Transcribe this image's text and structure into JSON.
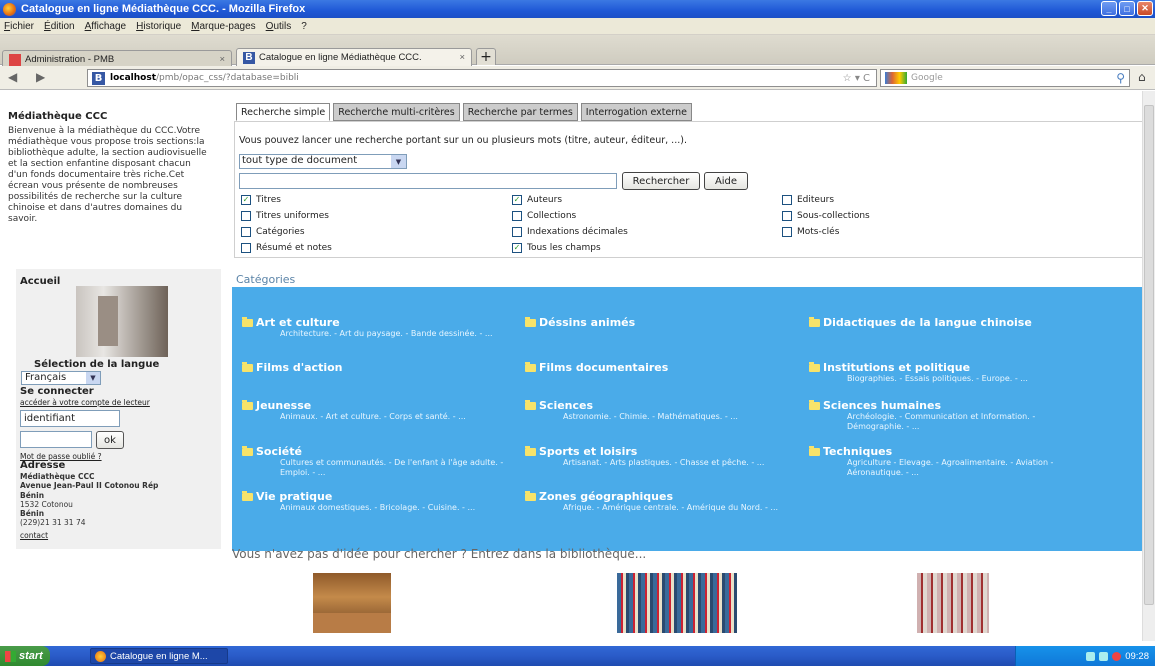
{
  "window": {
    "title": "Catalogue en ligne Médiathèque CCC. - Mozilla Firefox"
  },
  "menubar": [
    "Fichier",
    "Édition",
    "Affichage",
    "Historique",
    "Marque-pages",
    "Outils",
    "?"
  ],
  "tabs": [
    {
      "label": "Administration - PMB"
    },
    {
      "label": "Catalogue en ligne Médiathèque CCC."
    }
  ],
  "url": {
    "host": "localhost",
    "rest": "/pmb/opac_css/?database=bibli"
  },
  "google": {
    "placeholder": "Google"
  },
  "sidebar": {
    "heading": "Médiathèque CCC",
    "intro": "Bienvenue à la médiathèque du CCC.Votre médiathèque vous propose trois sections:la bibliothèque adulte, la section audiovisuelle et la section enfantine disposant chacun d'un fonds documentaire très riche.Cet écrean vous présente de nombreuses possibilités de recherche sur la culture chinoise et dans d'autres domaines du savoir.",
    "accueil": "Accueil",
    "lang_label": "Sélection de la langue",
    "lang_value": "Français",
    "connect": "Se connecter",
    "account_link": "accéder à votre compte de lecteur",
    "login_value": "identifiant",
    "ok": "ok",
    "forgot": "Mot de passe oublié ?",
    "address_label": "Adresse",
    "address_lines": [
      "Médiathèque CCC",
      "Avenue Jean-Paul II Cotonou Rép",
      "Bénin",
      "1532 Cotonou",
      "Bénin",
      "(229)21 31 31 74"
    ],
    "contact": "contact"
  },
  "search_tabs": [
    "Recherche simple",
    "Recherche multi-critères",
    "Recherche par termes",
    "Interrogation externe"
  ],
  "search": {
    "description": "Vous pouvez lancer une recherche portant sur un ou plusieurs mots (titre, auteur, éditeur, ...).",
    "doc_type": "tout type de document",
    "search_btn": "Rechercher",
    "help_btn": "Aide",
    "fields": [
      {
        "label": "Titres",
        "checked": true
      },
      {
        "label": "Auteurs",
        "checked": true
      },
      {
        "label": "Editeurs",
        "checked": false
      },
      {
        "label": "Titres uniformes",
        "checked": false
      },
      {
        "label": "Collections",
        "checked": false
      },
      {
        "label": "Sous-collections",
        "checked": false
      },
      {
        "label": "Catégories",
        "checked": false
      },
      {
        "label": "Indexations décimales",
        "checked": false
      },
      {
        "label": "Mots-clés",
        "checked": false
      },
      {
        "label": "Résumé et notes",
        "checked": false
      },
      {
        "label": "Tous les champs",
        "checked": true
      }
    ]
  },
  "categories_title": "Catégories",
  "categories": [
    {
      "name": "Art et culture",
      "sub": "Architecture. - Art du paysage. - Bande dessinée. - ..."
    },
    {
      "name": "Déssins animés",
      "sub": ""
    },
    {
      "name": "Didactiques de la langue chinoise",
      "sub": ""
    },
    {
      "name": "Films d'action",
      "sub": ""
    },
    {
      "name": "Films documentaires",
      "sub": ""
    },
    {
      "name": "Institutions et politique",
      "sub": "Biographies. - Essais politiques. - Europe. - ..."
    },
    {
      "name": "Jeunesse",
      "sub": "Animaux. - Art et culture. - Corps et santé. - ..."
    },
    {
      "name": "Sciences",
      "sub": "Astronomie. - Chimie. - Mathématiques. - ..."
    },
    {
      "name": "Sciences humaines",
      "sub": "Archéologie. - Communication et Information. - Démographie. - ..."
    },
    {
      "name": "Société",
      "sub": "Cultures et communautés. - De l'enfant à l'âge adulte. - Emploi. - ..."
    },
    {
      "name": "Sports et loisirs",
      "sub": "Artisanat. - Arts plastiques. - Chasse et pêche. - ..."
    },
    {
      "name": "Techniques",
      "sub": "Agriculture - Elevage. - Agroalimentaire. - Aviation - Aéronautique. - ..."
    },
    {
      "name": "Vie pratique",
      "sub": "Animaux domestiques. - Bricolage. - Cuisine. - ..."
    },
    {
      "name": "Zones géographiques",
      "sub": "Afrique. - Amérique centrale. - Amérique du Nord. - ..."
    }
  ],
  "no_idea": "Vous n'avez pas d'idée pour chercher ? Entrez dans la bibliothèque...",
  "taskbar": {
    "start": "start",
    "task": "Catalogue en ligne M...",
    "clock": "09:28"
  }
}
